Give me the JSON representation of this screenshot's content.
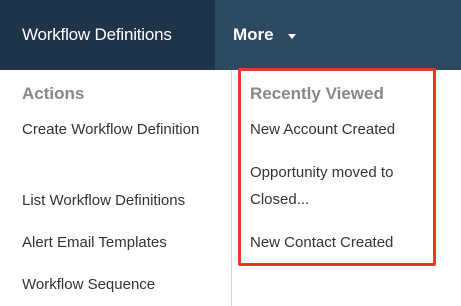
{
  "topbar": {
    "active_tab_label": "Workflow Definitions",
    "more_label": "More"
  },
  "actions": {
    "title": "Actions",
    "items": [
      {
        "label": "Create Workflow Definition"
      },
      {
        "label": "List Workflow Definitions"
      },
      {
        "label": "Alert Email Templates"
      },
      {
        "label": "Workflow Sequence"
      }
    ]
  },
  "recently_viewed": {
    "title": "Recently Viewed",
    "items": [
      {
        "label": "New Account Created"
      },
      {
        "label": "Opportunity moved to Closed..."
      },
      {
        "label": "New Contact Created"
      }
    ]
  },
  "colors": {
    "topbar_bg": "#2e4a63",
    "active_tab_bg": "#1f3448",
    "highlight_border": "#e43a2a"
  }
}
